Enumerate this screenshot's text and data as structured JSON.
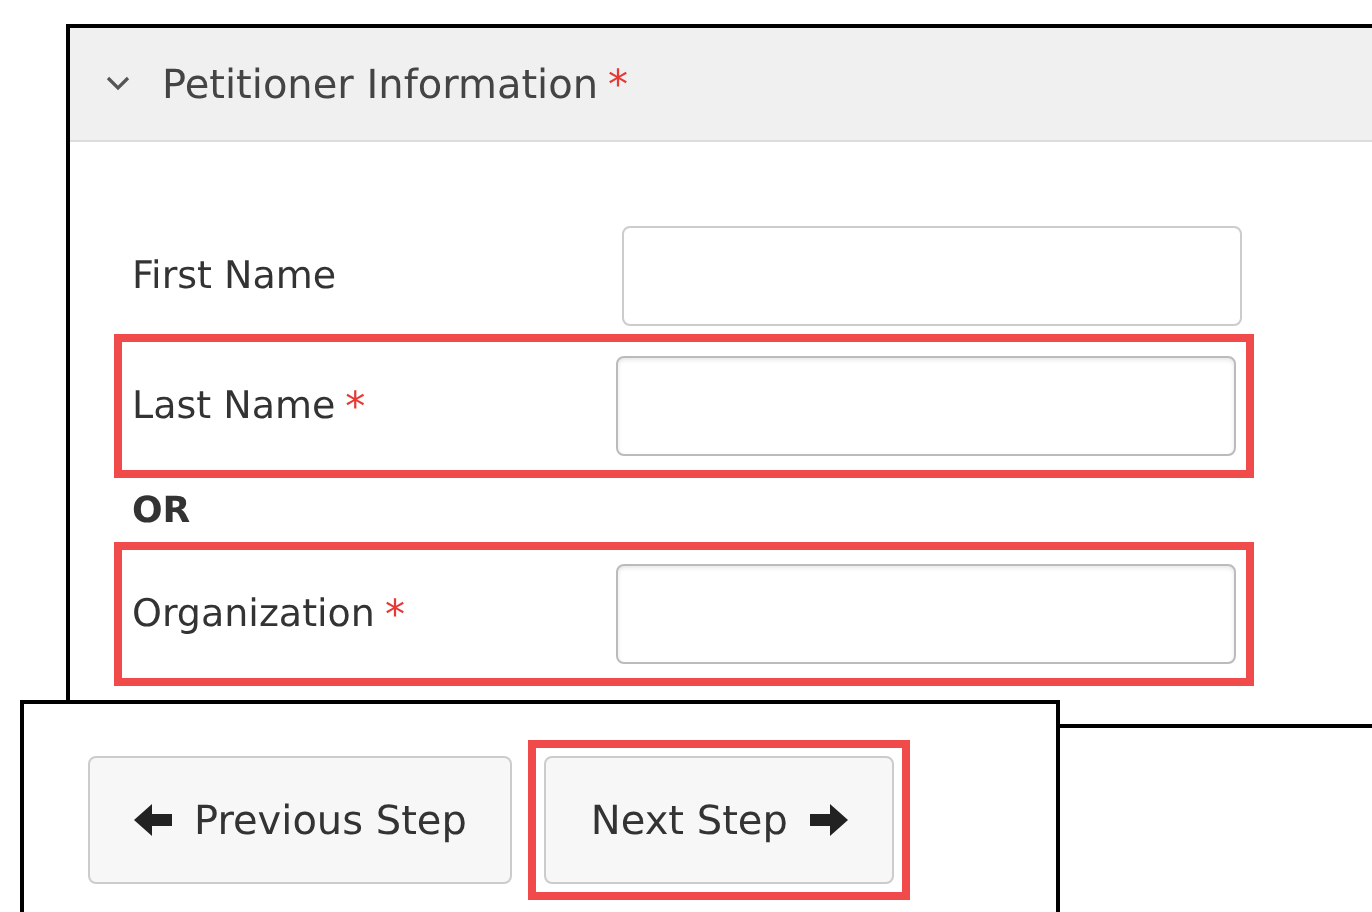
{
  "panel": {
    "title": "Petitioner Information",
    "required_mark": "*",
    "expanded": true
  },
  "fields": [
    {
      "kind": "field",
      "label": "First Name",
      "highlighted": false
    },
    {
      "kind": "field",
      "label": "Last Name",
      "required_mark": "*",
      "highlighted": true
    },
    {
      "kind": "separator",
      "label": "OR"
    },
    {
      "kind": "field",
      "label": "Organization",
      "required_mark": "*",
      "highlighted": true
    }
  ],
  "buttons": [
    {
      "label": "Previous Step",
      "kind": "previous",
      "highlighted": false
    },
    {
      "label": "Next Step",
      "kind": "next",
      "highlighted": true
    }
  ]
}
